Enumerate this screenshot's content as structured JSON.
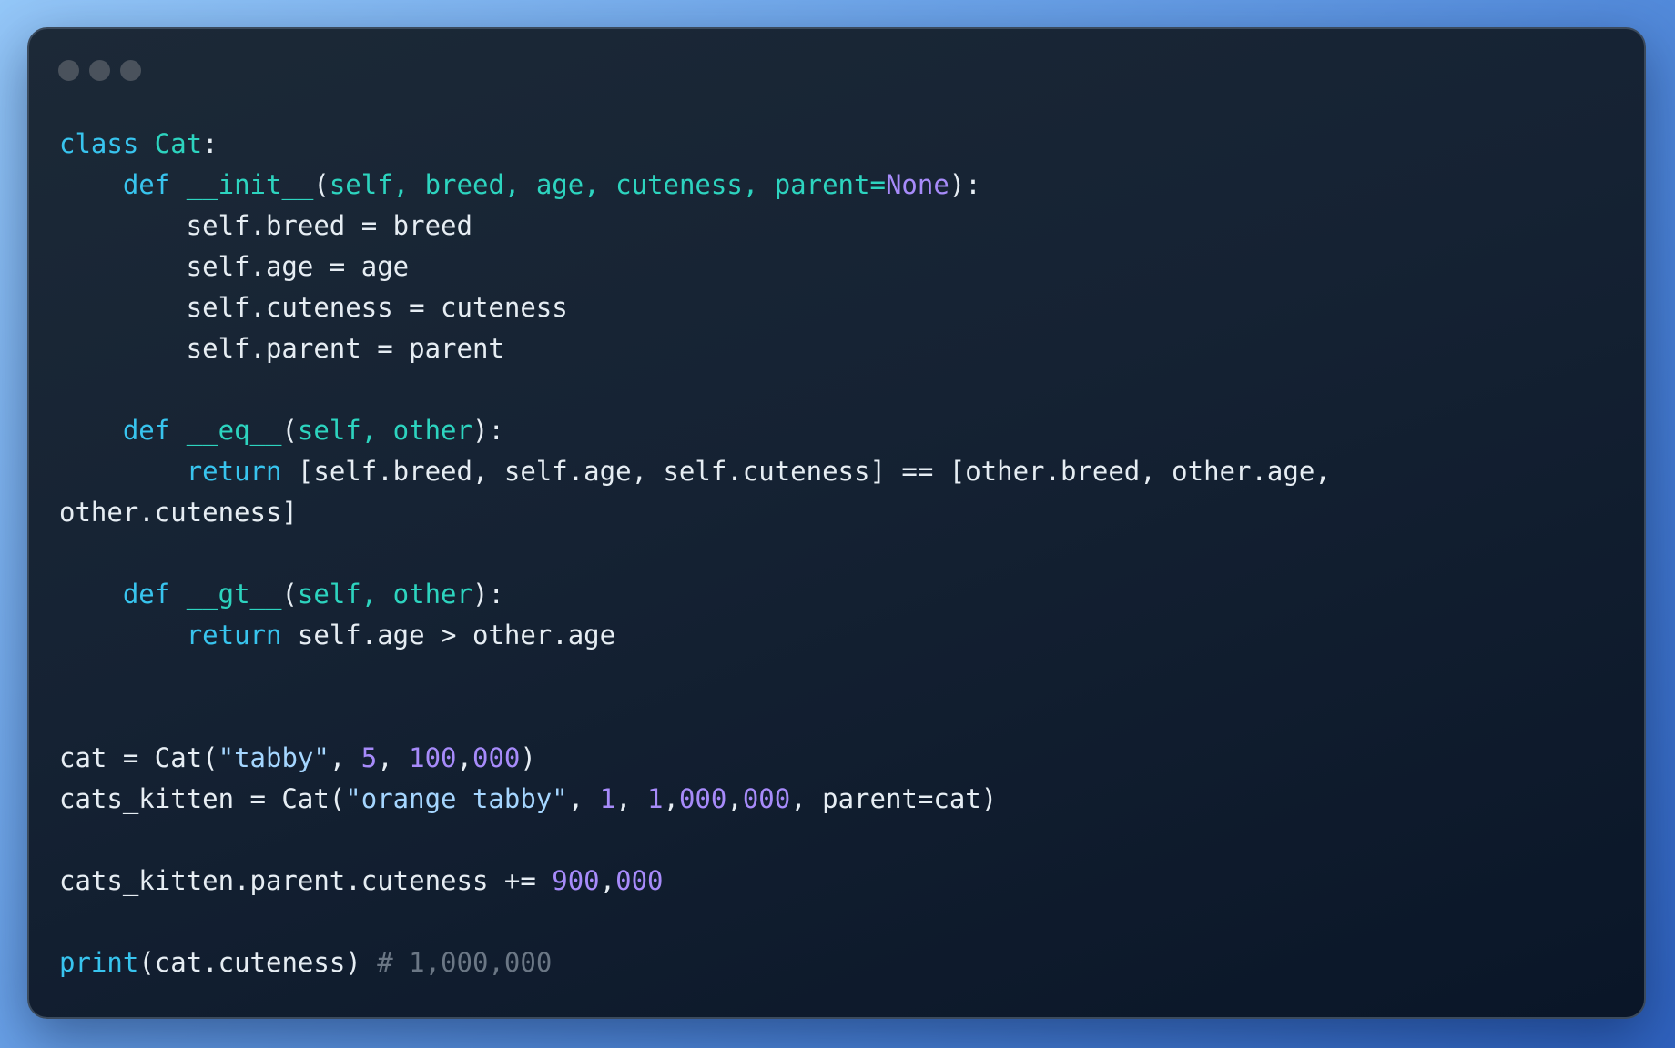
{
  "window": {
    "controls": [
      "close",
      "minimize",
      "zoom"
    ]
  },
  "colors": {
    "keyword": "#38c4ee",
    "class_name": "#2dd4bf",
    "function_name": "#2dd4bf",
    "parameter": "#2dd4bf",
    "builtin": "#a78bfa",
    "number": "#a78bfa",
    "string": "#a5d6ff",
    "comment": "#6b7785",
    "text": "#e6edf3"
  },
  "code": {
    "lines": [
      [
        [
          "keyword",
          "class "
        ],
        [
          "class",
          "Cat"
        ],
        [
          "plain",
          ":"
        ]
      ],
      [
        [
          "plain",
          "    "
        ],
        [
          "keyword",
          "def "
        ],
        [
          "func",
          "__init__"
        ],
        [
          "plain",
          "("
        ],
        [
          "param",
          "self, breed, age, cuteness, parent="
        ],
        [
          "builtin",
          "None"
        ],
        [
          "plain",
          "):"
        ]
      ],
      [
        [
          "plain",
          "        self.breed = breed"
        ]
      ],
      [
        [
          "plain",
          "        self.age = age"
        ]
      ],
      [
        [
          "plain",
          "        self.cuteness = cuteness"
        ]
      ],
      [
        [
          "plain",
          "        self.parent = parent"
        ]
      ],
      [],
      [
        [
          "plain",
          "    "
        ],
        [
          "keyword",
          "def "
        ],
        [
          "func",
          "__eq__"
        ],
        [
          "plain",
          "("
        ],
        [
          "param",
          "self, other"
        ],
        [
          "plain",
          "):"
        ]
      ],
      [
        [
          "plain",
          "        "
        ],
        [
          "keyword",
          "return "
        ],
        [
          "plain",
          "[self.breed, self.age, self.cuteness] == [other.breed, other.age,"
        ]
      ],
      [
        [
          "plain",
          "other.cuteness]"
        ]
      ],
      [],
      [
        [
          "plain",
          "    "
        ],
        [
          "keyword",
          "def "
        ],
        [
          "func",
          "__gt__"
        ],
        [
          "plain",
          "("
        ],
        [
          "param",
          "self, other"
        ],
        [
          "plain",
          "):"
        ]
      ],
      [
        [
          "plain",
          "        "
        ],
        [
          "keyword",
          "return "
        ],
        [
          "plain",
          "self.age > other.age"
        ]
      ],
      [],
      [],
      [
        [
          "plain",
          "cat = Cat("
        ],
        [
          "string",
          "\"tabby\""
        ],
        [
          "plain",
          ", "
        ],
        [
          "number",
          "5"
        ],
        [
          "plain",
          ", "
        ],
        [
          "number",
          "100"
        ],
        [
          "plain",
          ","
        ],
        [
          "number",
          "000"
        ],
        [
          "plain",
          ")"
        ]
      ],
      [
        [
          "plain",
          "cats_kitten = Cat("
        ],
        [
          "string",
          "\"orange tabby\""
        ],
        [
          "plain",
          ", "
        ],
        [
          "number",
          "1"
        ],
        [
          "plain",
          ", "
        ],
        [
          "number",
          "1"
        ],
        [
          "plain",
          ","
        ],
        [
          "number",
          "000"
        ],
        [
          "plain",
          ","
        ],
        [
          "number",
          "000"
        ],
        [
          "plain",
          ", parent=cat)"
        ]
      ],
      [],
      [
        [
          "plain",
          "cats_kitten.parent.cuteness += "
        ],
        [
          "number",
          "900"
        ],
        [
          "plain",
          ","
        ],
        [
          "number",
          "000"
        ]
      ],
      [],
      [
        [
          "keyword",
          "print"
        ],
        [
          "plain",
          "(cat.cuteness) "
        ],
        [
          "comment",
          "# 1,000,000"
        ]
      ]
    ]
  }
}
